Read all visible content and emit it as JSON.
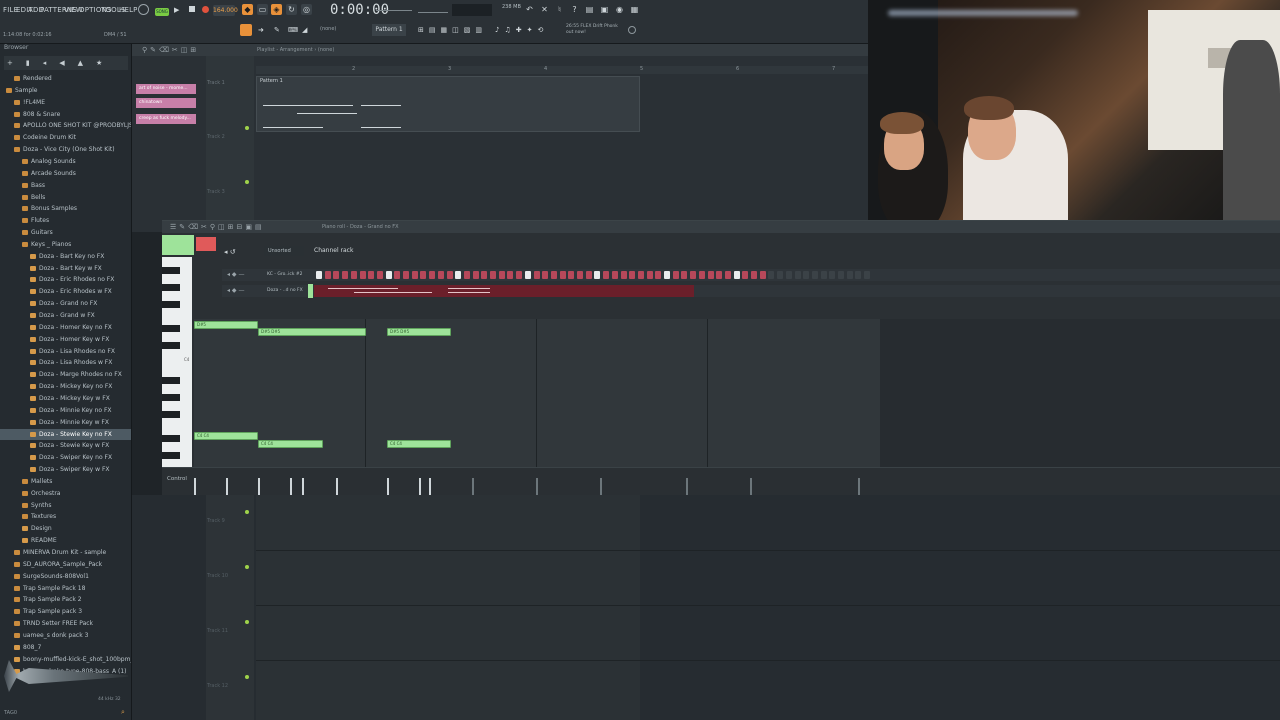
{
  "menu": [
    "FILE",
    "EDIT",
    "ADD",
    "PATTERNS",
    "VIEW",
    "OPTIONS",
    "TOOLS",
    "HELP"
  ],
  "transport": {
    "tempo": "164.000",
    "time": "0:00:00",
    "pattern": "Pattern 1",
    "cpu": "238 MB",
    "news": "26:55 FLEX Drift Phonk out now!"
  },
  "hint": "1:14:08 for 0:02:16",
  "hint_right": "DM4 / 51",
  "browser": {
    "title": "Browser",
    "items": [
      {
        "label": "Rendered",
        "type": "folder"
      },
      {
        "label": "Sample",
        "type": "folder"
      },
      {
        "label": "!FL4ME",
        "type": "folder"
      },
      {
        "label": "808 & Snare",
        "type": "folder"
      },
      {
        "label": "APOLLO ONE SHOT KIT @PRODBYLJS",
        "type": "folder"
      },
      {
        "label": "Codeine Drum Kit",
        "type": "folder"
      },
      {
        "label": "Doza - Vice City (One Shot Kit)",
        "type": "folder"
      },
      {
        "label": "Analog Sounds",
        "type": "folder"
      },
      {
        "label": "Arcade Sounds",
        "type": "folder"
      },
      {
        "label": "Bass",
        "type": "folder"
      },
      {
        "label": "Bells",
        "type": "folder"
      },
      {
        "label": "Bonus Samples",
        "type": "folder"
      },
      {
        "label": "Flutes",
        "type": "folder"
      },
      {
        "label": "Guitars",
        "type": "folder"
      },
      {
        "label": "Keys _ Pianos",
        "type": "folder"
      },
      {
        "label": "Doza - Bart Key no FX",
        "type": "file"
      },
      {
        "label": "Doza - Bart Key w FX",
        "type": "file"
      },
      {
        "label": "Doza - Eric Rhodes no FX",
        "type": "file"
      },
      {
        "label": "Doza - Eric Rhodes w FX",
        "type": "file"
      },
      {
        "label": "Doza - Grand no FX",
        "type": "file"
      },
      {
        "label": "Doza - Grand w FX",
        "type": "file"
      },
      {
        "label": "Doza - Homer Key no FX",
        "type": "file"
      },
      {
        "label": "Doza - Homer Key w FX",
        "type": "file"
      },
      {
        "label": "Doza - Lisa Rhodes no FX",
        "type": "file"
      },
      {
        "label": "Doza - Lisa Rhodes w FX",
        "type": "file"
      },
      {
        "label": "Doza - Marge Rhodes no FX",
        "type": "file"
      },
      {
        "label": "Doza - Mickey Key no FX",
        "type": "file"
      },
      {
        "label": "Doza - Mickey Key w FX",
        "type": "file"
      },
      {
        "label": "Doza - Minnie Key no FX",
        "type": "file"
      },
      {
        "label": "Doza - Minnie Key w FX",
        "type": "file"
      },
      {
        "label": "Doza - Stewie Key no FX",
        "type": "file",
        "selected": true
      },
      {
        "label": "Doza - Stewie Key w FX",
        "type": "file"
      },
      {
        "label": "Doza - Swiper Key no FX",
        "type": "file"
      },
      {
        "label": "Doza - Swiper Key w FX",
        "type": "file"
      },
      {
        "label": "Mallets",
        "type": "folder"
      },
      {
        "label": "Orchestra",
        "type": "folder"
      },
      {
        "label": "Synths",
        "type": "folder"
      },
      {
        "label": "Textures",
        "type": "folder"
      },
      {
        "label": "Design",
        "type": "file"
      },
      {
        "label": "README",
        "type": "file"
      },
      {
        "label": "MINERVA Drum Kit - sample",
        "type": "folder"
      },
      {
        "label": "SD_AURORA_Sample_Pack",
        "type": "folder"
      },
      {
        "label": "SurgeSounds-808Vol1",
        "type": "folder"
      },
      {
        "label": "Trap Sample Pack 18",
        "type": "folder"
      },
      {
        "label": "Trap Sample Pack 2",
        "type": "folder"
      },
      {
        "label": "Trap Sample pack 3",
        "type": "folder"
      },
      {
        "label": "TRND Setter FREE Pack",
        "type": "folder"
      },
      {
        "label": "uamee_s donk pack 3",
        "type": "folder"
      },
      {
        "label": "808_7",
        "type": "file"
      },
      {
        "label": "boony-muffled-kick-E_shot_100bpm_G_minor",
        "type": "file"
      },
      {
        "label": "bouncy-drake-type-808-bass_A (1)",
        "type": "file"
      }
    ],
    "footer_tag": "TAG0",
    "footer_info": "44 kHz 32"
  },
  "playlist": {
    "title": "Playlist - Arrangement › (none)",
    "patterns": [
      "art of noise - mome...",
      "chinatown",
      "creep as fuck melody..."
    ],
    "tracks": [
      "Track 1",
      "Track 2",
      "Track 3"
    ],
    "clip": "Pattern 1",
    "ruler": [
      "2",
      "3",
      "4",
      "5",
      "6",
      "7"
    ]
  },
  "pianoroll": {
    "title": "Piano roll - Doza - Grand no FX",
    "channel_rack": "Channel rack",
    "filter": "Unsorted",
    "channels": [
      "KC - Gro..ick #2",
      "Doza - ..d no FX"
    ],
    "control": "Control",
    "key_label": "C4"
  },
  "bottom_tracks": [
    "Track 9",
    "Track 10",
    "Track 11",
    "Track 12"
  ]
}
